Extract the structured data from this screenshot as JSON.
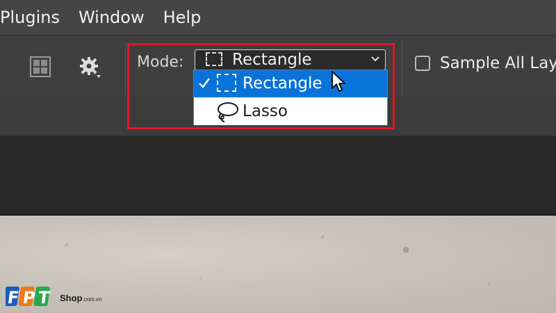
{
  "menubar": {
    "items": [
      "Plugins",
      "Window",
      "Help"
    ]
  },
  "options": {
    "mode_label": "Mode:",
    "mode_value": "Rectangle",
    "sample_all_layers_label": "Sample All Layers",
    "sample_all_layers_checked": false
  },
  "dropdown": {
    "options": [
      {
        "label": "Rectangle",
        "selected": true,
        "icon": "rectangle-marquee-icon"
      },
      {
        "label": "Lasso",
        "selected": false,
        "icon": "lasso-icon"
      }
    ]
  },
  "watermark": {
    "brand": "FPT",
    "shop": "Shop",
    "domain": ".com.vn"
  },
  "colors": {
    "highlight": "#e0182a",
    "selection": "#0a73d9",
    "fpt_blue": "#1c5bbf",
    "fpt_orange": "#f07b16",
    "fpt_green": "#2aa84a"
  }
}
